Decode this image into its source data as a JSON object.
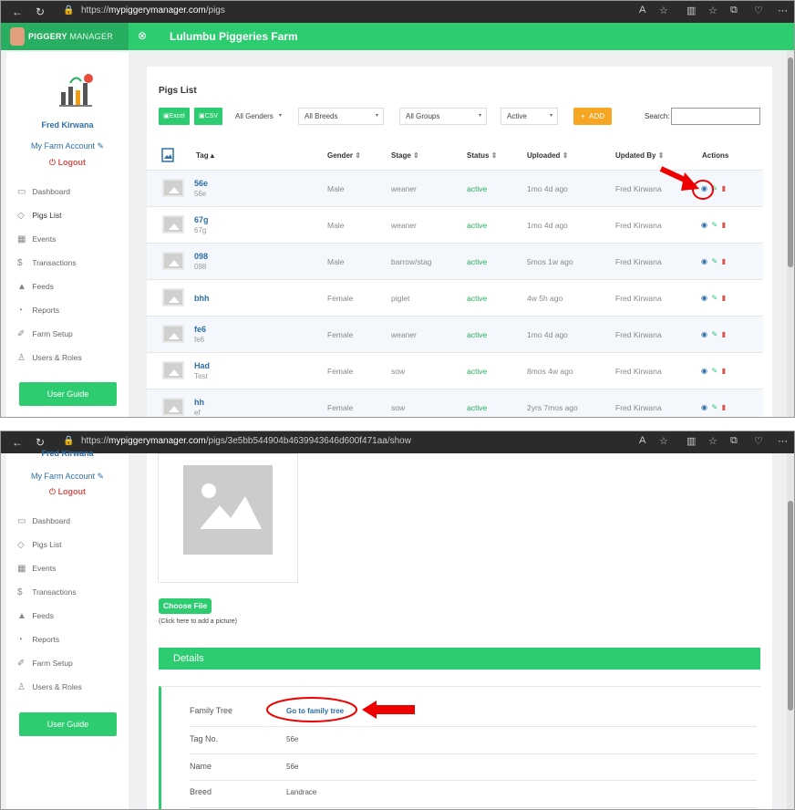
{
  "shot1": {
    "browser": {
      "url_prefix": "https://",
      "url_host": "mypiggerymanager.com",
      "url_path": "/pigs"
    },
    "app": {
      "brand_bold": "PIGGERY",
      "brand_rest": "MANAGER",
      "farm_name": "Lulumbu Piggeries Farm"
    },
    "sidebar": {
      "user": "Fred Kirwana",
      "account": "My Farm Account",
      "logout": "Logout",
      "items": [
        {
          "label": "Dashboard",
          "icon": "monitor-icon"
        },
        {
          "label": "Pigs List",
          "icon": "tag-icon"
        },
        {
          "label": "Events",
          "icon": "calendar-icon"
        },
        {
          "label": "Transactions",
          "icon": "dollar-icon"
        },
        {
          "label": "Feeds",
          "icon": "feed-bag-icon"
        },
        {
          "label": "Reports",
          "icon": "reports-icon"
        },
        {
          "label": "Farm Setup",
          "icon": "wrench-icon"
        },
        {
          "label": "Users & Roles",
          "icon": "users-icon"
        }
      ],
      "guide": "User Guide"
    },
    "list": {
      "title": "Pigs List",
      "excel": "Excel",
      "csv": "CSV",
      "gender_filter": "All Genders",
      "breed_filter": "All Breeds",
      "group_filter": "All Groups",
      "status_filter": "Active",
      "add": "ADD",
      "search_label": "Search:",
      "columns": [
        "Tag",
        "Gender",
        "Stage",
        "Status",
        "Uploaded",
        "Updated By",
        "Actions"
      ],
      "rows": [
        {
          "tag": "56e",
          "sub": "56e",
          "gender": "Male",
          "stage": "weaner",
          "status": "active",
          "uploaded": "1mo 4d ago",
          "by": "Fred Kirwana"
        },
        {
          "tag": "67g",
          "sub": "67g",
          "gender": "Male",
          "stage": "weaner",
          "status": "active",
          "uploaded": "1mo 4d ago",
          "by": "Fred Kirwana"
        },
        {
          "tag": "098",
          "sub": "098",
          "gender": "Male",
          "stage": "barrow/stag",
          "status": "active",
          "uploaded": "5mos 1w ago",
          "by": "Fred Kirwana"
        },
        {
          "tag": "bhh",
          "sub": "",
          "gender": "Female",
          "stage": "piglet",
          "status": "active",
          "uploaded": "4w 5h ago",
          "by": "Fred Kirwana"
        },
        {
          "tag": "fe6",
          "sub": "fe6",
          "gender": "Female",
          "stage": "weaner",
          "status": "active",
          "uploaded": "1mo 4d ago",
          "by": "Fred Kirwana"
        },
        {
          "tag": "Had",
          "sub": "Test",
          "gender": "Female",
          "stage": "sow",
          "status": "active",
          "uploaded": "8mos 4w ago",
          "by": "Fred Kirwana"
        },
        {
          "tag": "hh",
          "sub": "ef",
          "gender": "Female",
          "stage": "sow",
          "status": "active",
          "uploaded": "2yrs 7mos ago",
          "by": "Fred Kirwana"
        }
      ]
    }
  },
  "shot2": {
    "browser": {
      "url_prefix": "https://",
      "url_host": "mypiggerymanager.com",
      "url_path": "/pigs/3e5bb544904b4639943646d600f471aa/show"
    },
    "sidebar": {
      "user": "Fred Kirwana",
      "account": "My Farm Account",
      "logout": "Logout",
      "guide": "User Guide"
    },
    "photo": {
      "choose": "Choose File",
      "hint": "(Click here to add a picture)"
    },
    "details": {
      "header": "Details",
      "fields": [
        {
          "label": "Family Tree",
          "value": "Go to family tree"
        },
        {
          "label": "Tag No.",
          "value": "56e"
        },
        {
          "label": "Name",
          "value": "56e"
        },
        {
          "label": "Breed",
          "value": "Landrace"
        }
      ]
    }
  },
  "colors": {
    "primary_green": "#2ecc71",
    "link_blue": "#2e6fa7",
    "danger_red": "#d9534f",
    "add_orange": "#f5a623",
    "annotation_red": "#e00000"
  }
}
